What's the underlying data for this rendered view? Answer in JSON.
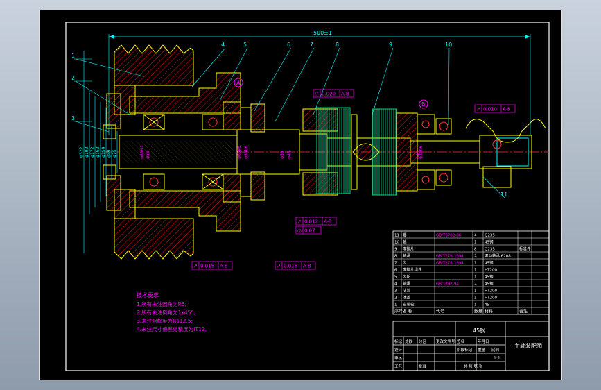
{
  "colors": {
    "frame": "#ffffff",
    "part": "#ffff00",
    "hatch": "#ff0000",
    "dimension": "#00ffff",
    "leader": "#00ffff",
    "tolerance": "#ff00ff",
    "note": "#ff00ff",
    "center": "#ff3333",
    "green": "#00ff00"
  },
  "dimensions": {
    "overall_length": "500±1",
    "diameters": [
      "φ322",
      "φ192",
      "φ172",
      "φ162",
      "φ154",
      "φ89",
      "φ75"
    ],
    "bore_labels": [
      "φ65H7",
      "φ56"
    ],
    "shaft_labels": [
      "φ65k6",
      "φ50h6",
      "φ55",
      "φ45",
      "φ40",
      "φ35h6"
    ]
  },
  "balloons": [
    "1",
    "2",
    "3",
    "4",
    "5",
    "6",
    "7",
    "8",
    "9",
    "10",
    "11"
  ],
  "datums": [
    "A",
    "B"
  ],
  "tolerances": [
    {
      "symbol": "//",
      "value": "0.020",
      "datum": "A-B"
    },
    {
      "symbol": "↗",
      "value": "0.010",
      "datum": "A-B"
    },
    {
      "symbol": "↗",
      "value": "0.012",
      "datum": "A-B"
    },
    {
      "symbol": "◎",
      "value": "0.07",
      "datum": ""
    },
    {
      "symbol": "↗",
      "value": "0.015",
      "datum": "A-B"
    },
    {
      "symbol": "↗",
      "value": "0.015",
      "datum": "A-B"
    }
  ],
  "notes": {
    "title": "技术要求",
    "items": [
      "1.所有未注圆角为R5;",
      "2.所有未注倒角为1x45°;",
      "3.未注粗糙度为Ra12.5;",
      "4.未注尺寸偏差处精度为IT12。"
    ]
  },
  "bom": {
    "rows": [
      {
        "no": "11",
        "name": "螺",
        "code": "GB/T5782-86",
        "qty": "4",
        "mat": "Q235",
        "note": ""
      },
      {
        "no": "10",
        "name": "轴",
        "code": "",
        "qty": "1",
        "mat": "45钢",
        "note": ""
      },
      {
        "no": "9",
        "name": "摩擦片",
        "code": "",
        "qty": "8",
        "mat": "Q235",
        "note": "标准件"
      },
      {
        "no": "8",
        "name": "轴承",
        "code": "GB/T276-1994",
        "qty": "2",
        "mat": "滚动轴承 6208",
        "note": ""
      },
      {
        "no": "7",
        "name": "齿",
        "code": "GB/T276-1994",
        "qty": "1",
        "mat": "45钢",
        "note": ""
      },
      {
        "no": "6",
        "name": "摩擦片组件",
        "code": "",
        "qty": "1",
        "mat": "HT200",
        "note": ""
      },
      {
        "no": "5",
        "name": "齿轮",
        "code": "",
        "qty": "1",
        "mat": "45钢",
        "note": ""
      },
      {
        "no": "4",
        "name": "轴承",
        "code": "GB/T297-94",
        "qty": "2",
        "mat": "45钢",
        "note": ""
      },
      {
        "no": "3",
        "name": "法兰",
        "code": "",
        "qty": "1",
        "mat": "HT200",
        "note": ""
      },
      {
        "no": "2",
        "name": "端盖",
        "code": "",
        "qty": "1",
        "mat": "HT200",
        "note": ""
      },
      {
        "no": "1",
        "name": "皮带轮",
        "code": "",
        "qty": "1",
        "mat": "45",
        "note": ""
      }
    ],
    "header": {
      "no": "序号",
      "name": "名 称",
      "code": "代号",
      "qty": "数量",
      "mat": "材料",
      "note": "备注"
    }
  },
  "title_block": {
    "material": "45钢",
    "drawing_name": "主轴装配图",
    "scale_label": "比例",
    "scale": "1:1",
    "sheet_label": "共 张 第 张",
    "row_labels": [
      "标记",
      "处数",
      "分区",
      "更改文件号",
      "签名",
      "年月日"
    ],
    "roles": [
      "设计",
      "审核",
      "工艺",
      "批准"
    ],
    "stage_label": "阶段标记",
    "weight_label": "重量"
  }
}
